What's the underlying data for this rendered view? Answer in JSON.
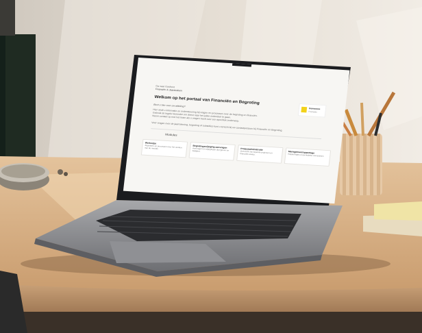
{
  "screen": {
    "header": {
      "overline": "Ga naar Gosfront",
      "breadcrumb": "Financiën & Jaarstukken",
      "title": "Welkom op het portaal van Financiën en Begroting"
    },
    "intro": {
      "question": "Bent u hier voor uw afdeling?",
      "paragraphs": [
        "Hier vindt u informatie en ondersteuning bij vragen en processen over de begroting en financiën.",
        "Gebruik de tegels hieronder om direct naar het juiste onderdeel te gaan.",
        "Neem contact op met het team als u vragen heeft over een specifiek onderwerp."
      ],
      "note": "Voor vragen over de jaarrekening, begroting of subsidies kunt u terecht bij uw contactpersoon bij Financiën en Begroting."
    },
    "logo": {
      "name": "Gemeente",
      "subtitle": "Financiën"
    },
    "section_label": "Modules",
    "cards": [
      {
        "title": "Werkwijze",
        "desc": "Afspraken en processen over het werken met de module."
      },
      {
        "title": "Begrotingswijziging aanvragen",
        "desc": "Aanvragen en wijzigingen doorgeven en bekijken."
      },
      {
        "title": "Projectadministratie",
        "desc": "Overzicht van lopende projecten en financiële status."
      },
      {
        "title": "Managementrapportage",
        "desc": "Rapportages en periodieke overzichten."
      }
    ]
  },
  "colors": {
    "logo_yellow": "#f2d21b",
    "screen_bg": "#f7f6f3",
    "laptop_body": "#8c8d91",
    "desk": "#d7b48c"
  }
}
